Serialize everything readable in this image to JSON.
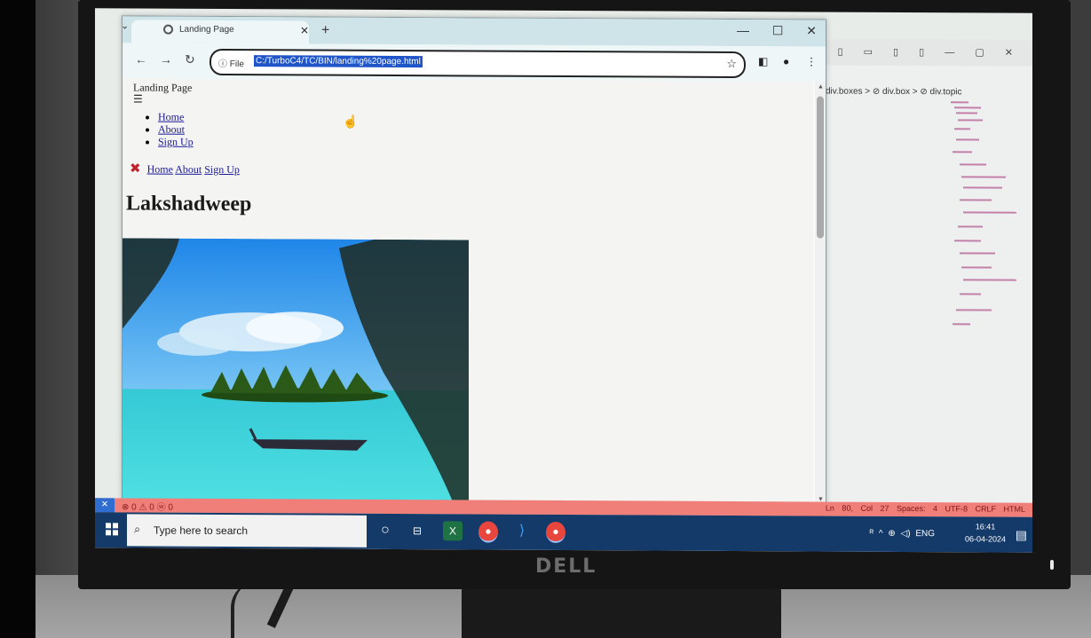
{
  "browser": {
    "tab_title": "Landing Page",
    "tab_menu": "⌄",
    "tab_close": "✕",
    "new_tab": "+",
    "window_controls": "— ☐ ✕",
    "back": "←",
    "forward": "→",
    "reload": "↻",
    "address_prefix": "ⓘ File",
    "url": "C:/TurboC4/TC/BIN/landing%20page.html",
    "star": "☆"
  },
  "page": {
    "title": "Landing Page",
    "hamburger": "☰",
    "menu": [
      "Home",
      "About",
      "Sign Up"
    ],
    "nav_close": "✖",
    "nav_links": [
      "Home",
      "About",
      "Sign Up"
    ],
    "heading": "Lakshadweep"
  },
  "vscode": {
    "breadcrumb": "div.boxes > ⊘ div.box > ⊘ div.topic",
    "status_left": "⊗ 0 ⚠ 0   ⓦ 0",
    "status_right": "Ln 80, Col 27  Spaces: 4  UTF-8  CRLF  HTML",
    "remote": "✕"
  },
  "taskbar": {
    "search_placeholder": "Type here to search",
    "tray": "ᴿ ^ ⊕ ◁) ENG",
    "time": "16:41",
    "date": "06-04-2024"
  },
  "monitor": {
    "brand": "DELL"
  },
  "colors": {
    "statusbar": "#f07f7a",
    "taskbar": "#143a6a",
    "url_highlight": "#1f55c8",
    "close_x": "#c0232d"
  }
}
